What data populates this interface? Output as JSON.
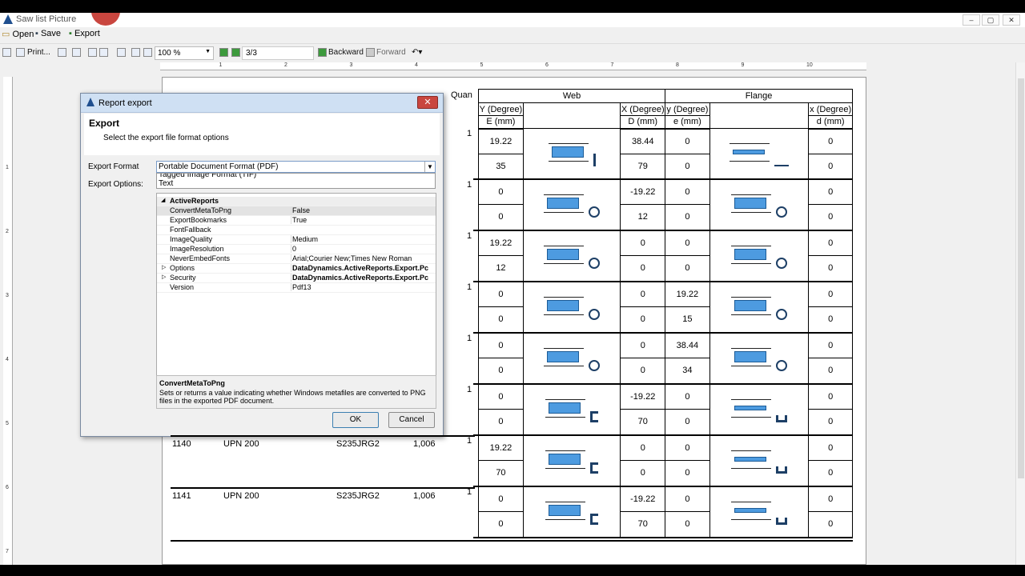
{
  "app": {
    "title": "Saw list Picture"
  },
  "menu": {
    "open": "Open",
    "save": "Save",
    "export": "Export"
  },
  "toolbar": {
    "print": "Print...",
    "zoom": "100 %",
    "page": "3/3",
    "backward": "Backward",
    "forward": "Forward"
  },
  "table": {
    "group_web": "Web",
    "group_flange": "Flange",
    "col_quan": "Quan",
    "h_y_degree": "Y (Degree)",
    "h_x_degree": "X (Degree)",
    "h_y_degree2": "y (Degree)",
    "h_x_degree2": "x (Degree)",
    "h_E_mm": "E (mm)",
    "h_D_mm": "D (mm)",
    "h_e_mm": "e (mm)",
    "h_d_mm": "d (mm)",
    "rows": [
      {
        "quan": "1",
        "Y": [
          "19.22",
          "35"
        ],
        "X": [
          "38.44",
          "79"
        ],
        "y": [
          "0",
          "0"
        ],
        "x": [
          "0",
          "0"
        ],
        "web_symbol": "I",
        "flange_symbol": "flat"
      },
      {
        "quan": "1",
        "Y": [
          "0",
          "0"
        ],
        "X": [
          "-19.22",
          "12"
        ],
        "y": [
          "0",
          "0"
        ],
        "x": [
          "0",
          "0"
        ],
        "web_symbol": "O",
        "flange_symbol": "O"
      },
      {
        "quan": "1",
        "Y": [
          "19.22",
          "12"
        ],
        "X": [
          "0",
          "0"
        ],
        "y": [
          "0",
          "0"
        ],
        "x": [
          "0",
          "0"
        ],
        "web_symbol": "O",
        "flange_symbol": "O"
      },
      {
        "quan": "1",
        "Y": [
          "0",
          "0"
        ],
        "X": [
          "0",
          "0"
        ],
        "y": [
          "19.22",
          "15"
        ],
        "x": [
          "0",
          "0"
        ],
        "web_symbol": "O",
        "flange_symbol": "O"
      },
      {
        "quan": "1",
        "Y": [
          "0",
          "0"
        ],
        "X": [
          "0",
          "0"
        ],
        "y": [
          "38.44",
          "34"
        ],
        "x": [
          "0",
          "0"
        ],
        "web_symbol": "O",
        "flange_symbol": "O"
      },
      {
        "quan": "1",
        "Y": [
          "0",
          "0"
        ],
        "X": [
          "-19.22",
          "70"
        ],
        "y": [
          "0",
          "0"
        ],
        "x": [
          "0",
          "0"
        ],
        "web_symbol": "C",
        "flange_symbol": "U"
      },
      {
        "id": "1140",
        "profile": "UPN 200",
        "material": "S235JRG2",
        "length": "1,006",
        "quan": "1",
        "Y": [
          "19.22",
          "70"
        ],
        "X": [
          "0",
          "0"
        ],
        "y": [
          "0",
          "0"
        ],
        "x": [
          "0",
          "0"
        ],
        "web_symbol": "C",
        "flange_symbol": "U"
      },
      {
        "id": "1141",
        "profile": "UPN 200",
        "material": "S235JRG2",
        "length": "1,006",
        "quan": "1",
        "Y": [
          "0",
          "0"
        ],
        "X": [
          "-19.22",
          "70"
        ],
        "y": [
          "0",
          "0"
        ],
        "x": [
          "0",
          "0"
        ],
        "web_symbol": "C",
        "flange_symbol": "U"
      }
    ]
  },
  "dialog": {
    "title": "Report export",
    "heading": "Export",
    "subtitle": "Select the export file format options",
    "export_format_label": "Export Format",
    "export_options_label": "Export Options:",
    "format_value": "Portable Document Format (PDF)",
    "format_options": [
      "Tagged Image Format (TIF)",
      "Text"
    ],
    "category": "ActiveReports",
    "properties": [
      {
        "name": "ConvertMetaToPng",
        "value": "False"
      },
      {
        "name": "ExportBookmarks",
        "value": "True"
      },
      {
        "name": "FontFallback",
        "value": ""
      },
      {
        "name": "ImageQuality",
        "value": "Medium"
      },
      {
        "name": "ImageResolution",
        "value": "0"
      },
      {
        "name": "NeverEmbedFonts",
        "value": "Arial;Courier New;Times New Roman"
      },
      {
        "name": "Options",
        "value": "DataDynamics.ActiveReports.Export.Pc"
      },
      {
        "name": "Security",
        "value": "DataDynamics.ActiveReports.Export.Pc"
      },
      {
        "name": "Version",
        "value": "Pdf13"
      }
    ],
    "desc_title": "ConvertMetaToPng",
    "desc_text": "Sets or returns a value indicating whether Windows metafiles are converted to PNG files in the exported PDF document.",
    "ok": "OK",
    "cancel": "Cancel"
  },
  "colors": {
    "accent": "#4d9be0",
    "close": "#c9463f"
  }
}
